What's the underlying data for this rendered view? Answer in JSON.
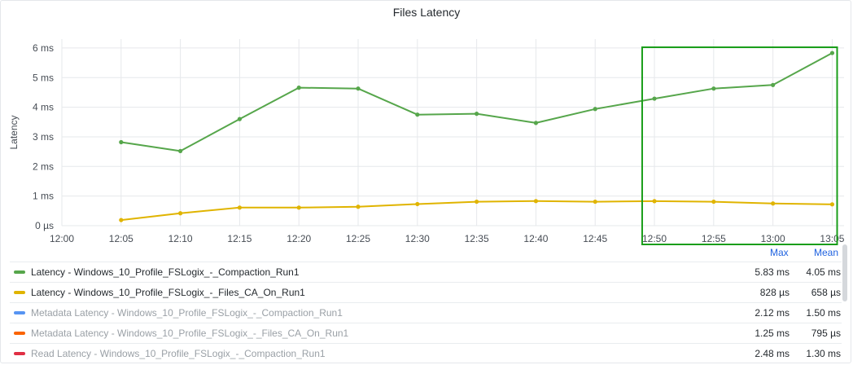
{
  "panel": {
    "title": "Files Latency"
  },
  "chart_data": {
    "type": "line",
    "title": "Files Latency",
    "ylabel": "Latency",
    "xlabel": "",
    "ylim_ms": [
      0,
      6.3
    ],
    "xlim": [
      "12:00",
      "13:06"
    ],
    "y_ticks": [
      {
        "value": 0,
        "label": "0 µs"
      },
      {
        "value": 1,
        "label": "1 ms"
      },
      {
        "value": 2,
        "label": "2 ms"
      },
      {
        "value": 3,
        "label": "3 ms"
      },
      {
        "value": 4,
        "label": "4 ms"
      },
      {
        "value": 5,
        "label": "5 ms"
      },
      {
        "value": 6,
        "label": "6 ms"
      }
    ],
    "x_ticks": [
      "12:00",
      "12:05",
      "12:10",
      "12:15",
      "12:20",
      "12:25",
      "12:30",
      "12:35",
      "12:40",
      "12:45",
      "12:50",
      "12:55",
      "13:00",
      "13:05"
    ],
    "grid": true,
    "series": [
      {
        "name": "Latency - Windows_10_Profile_FSLogix_-_Compaction_Run1",
        "color": "#56a64b",
        "x": [
          "12:05",
          "12:10",
          "12:15",
          "12:20",
          "12:25",
          "12:30",
          "12:35",
          "12:40",
          "12:45",
          "12:50",
          "12:55",
          "13:00",
          "13:05"
        ],
        "values_ms": [
          2.82,
          2.52,
          3.6,
          4.66,
          4.63,
          3.75,
          3.78,
          3.47,
          3.94,
          4.29,
          4.63,
          4.75,
          5.83
        ]
      },
      {
        "name": "Latency - Windows_10_Profile_FSLogix_-_Files_CA_On_Run1",
        "color": "#e0b400",
        "x": [
          "12:05",
          "12:10",
          "12:15",
          "12:20",
          "12:25",
          "12:30",
          "12:35",
          "12:40",
          "12:45",
          "12:50",
          "12:55",
          "13:00",
          "13:05"
        ],
        "values_ms": [
          0.19,
          0.42,
          0.61,
          0.61,
          0.64,
          0.73,
          0.81,
          0.83,
          0.81,
          0.828,
          0.81,
          0.75,
          0.72
        ]
      }
    ],
    "highlight_box": {
      "x_from": "12:49",
      "x_to": "13:06",
      "color": "#1a9e1a"
    }
  },
  "legend": {
    "max_header": "Max",
    "mean_header": "Mean",
    "rows": [
      {
        "name": "Latency - Windows_10_Profile_FSLogix_-_Compaction_Run1",
        "color": "#56a64b",
        "max": "5.83 ms",
        "mean": "4.05 ms",
        "hidden": false
      },
      {
        "name": "Latency - Windows_10_Profile_FSLogix_-_Files_CA_On_Run1",
        "color": "#e0b400",
        "max": "828 µs",
        "mean": "658 µs",
        "hidden": false
      },
      {
        "name": "Metadata Latency - Windows_10_Profile_FSLogix_-_Compaction_Run1",
        "color": "#5794f2",
        "max": "2.12 ms",
        "mean": "1.50 ms",
        "hidden": true
      },
      {
        "name": "Metadata Latency - Windows_10_Profile_FSLogix_-_Files_CA_On_Run1",
        "color": "#fa6400",
        "max": "1.25 ms",
        "mean": "795 µs",
        "hidden": true
      },
      {
        "name": "Read Latency - Windows_10_Profile_FSLogix_-_Compaction_Run1",
        "color": "#e02f44",
        "max": "2.48 ms",
        "mean": "1.30 ms",
        "hidden": true
      }
    ]
  }
}
